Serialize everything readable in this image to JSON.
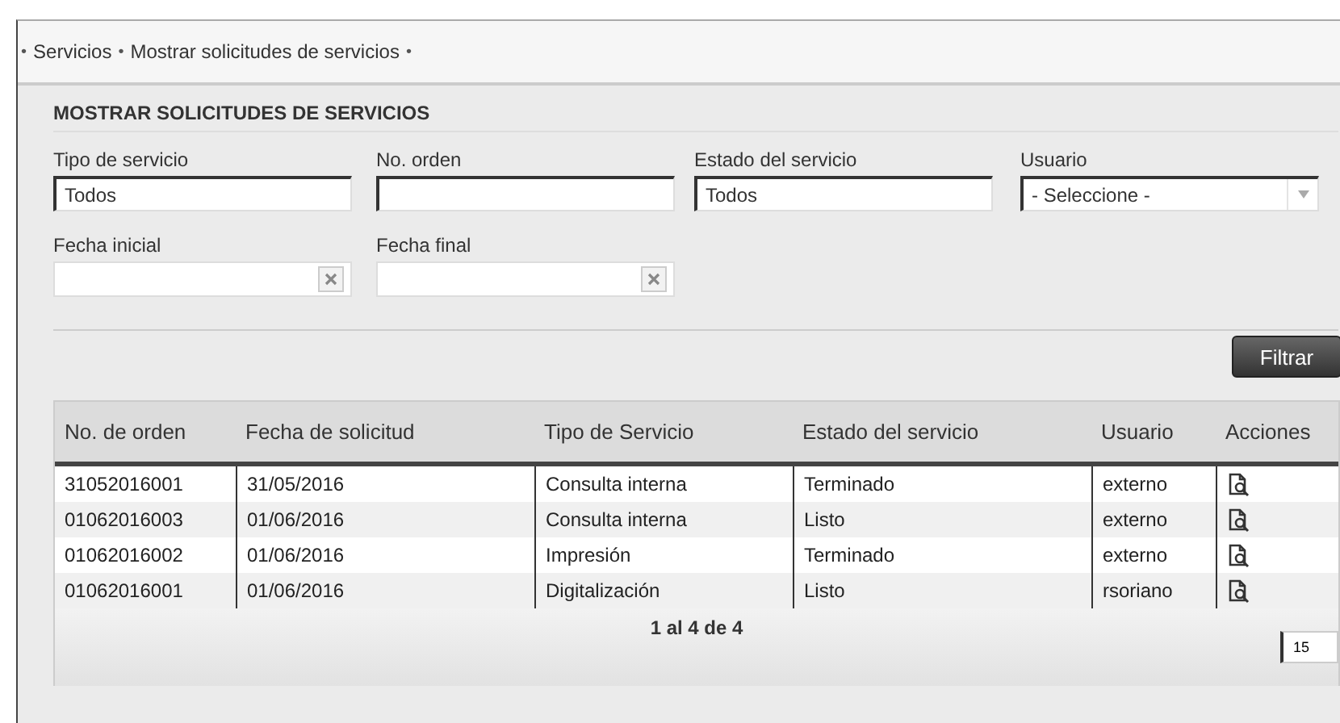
{
  "breadcrumb": [
    {
      "kind": "separator",
      "text": "•"
    },
    {
      "kind": "link",
      "text": "Servicios"
    },
    {
      "kind": "separator",
      "text": "•"
    },
    {
      "kind": "link",
      "text": "Mostrar solicitudes de servicios"
    },
    {
      "kind": "separator",
      "text": "•"
    }
  ],
  "title": "MOSTRAR SOLICITUDES DE SERVICIOS",
  "filters": [
    {
      "kind": "text",
      "label": "Tipo de servicio",
      "value": "Todos"
    },
    {
      "kind": "text",
      "label": "No. orden"
    },
    {
      "kind": "text",
      "label": "Estado del servicio",
      "value": "Todos"
    },
    {
      "kind": "select",
      "label": "Usuario",
      "value": "- Seleccione -"
    },
    {
      "kind": "date",
      "label": "Fecha inicial"
    },
    {
      "kind": "date",
      "label": "Fecha final"
    }
  ],
  "filter_button": "Filtrar",
  "table": {
    "columns": [
      "No. de orden",
      "Fecha de solicitud",
      "Tipo de Servicio",
      "Estado del servicio",
      "Usuario",
      "Acciones"
    ],
    "rows": [
      [
        "31052016001",
        "31/05/2016",
        "Consulta interna",
        "Terminado",
        "externo"
      ],
      [
        "01062016003",
        "01/06/2016",
        "Consulta interna",
        "Listo",
        "externo"
      ],
      [
        "01062016002",
        "01/06/2016",
        "Impresión",
        "Terminado",
        "externo"
      ],
      [
        "01062016001",
        "01/06/2016",
        "Digitalización",
        "Listo",
        "rsoriano"
      ]
    ]
  },
  "pagination": {
    "summary": "1 al 4 de 4",
    "page_size": "15"
  }
}
